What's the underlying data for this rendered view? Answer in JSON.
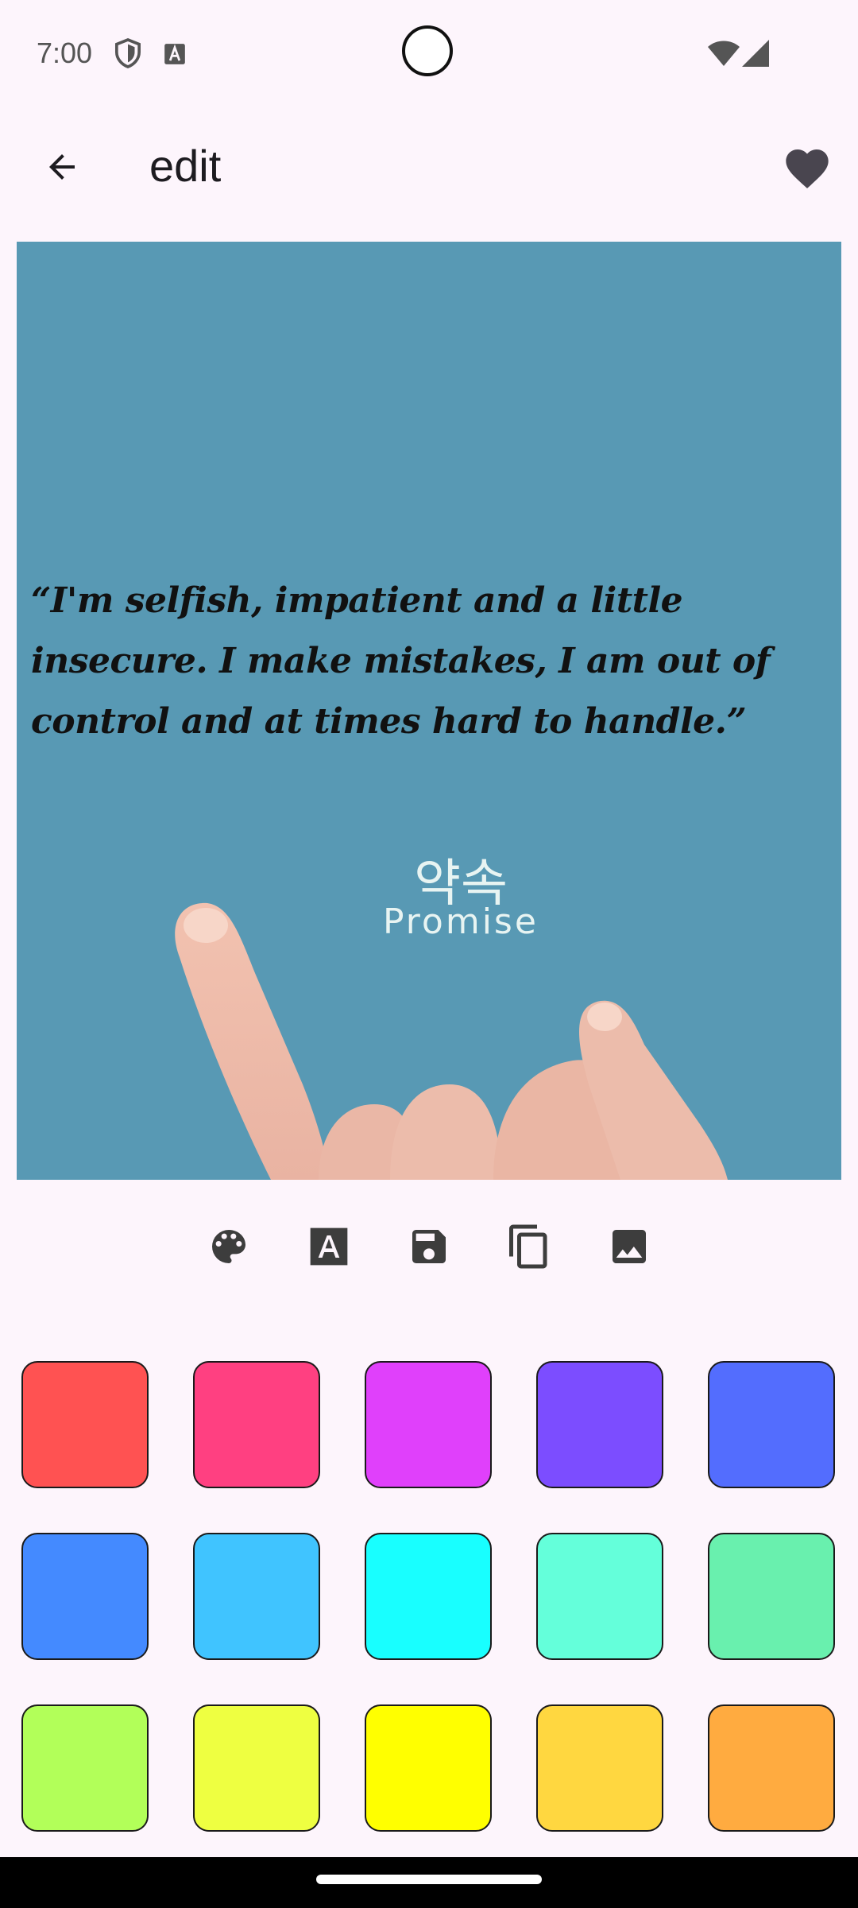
{
  "status_bar": {
    "time": "7:00"
  },
  "app_bar": {
    "title": "edit"
  },
  "preview": {
    "quote": "“I'm selfish, impatient and a little insecure. I make mistakes, I am out of control and at times hard to handle.”",
    "watermark_korean": "약속",
    "watermark_english": "Promise",
    "background_color": "#5899b4"
  },
  "toolbar": {
    "icons": [
      "palette-icon",
      "text-format-icon",
      "save-icon",
      "copy-icon",
      "image-icon"
    ]
  },
  "swatches": [
    [
      "#ff5252",
      "#ff4081",
      "#e040fb",
      "#7c4dff",
      "#536dfe"
    ],
    [
      "#448aff",
      "#40c4ff",
      "#18ffff",
      "#64ffda",
      "#69f0ae"
    ],
    [
      "#b2ff59",
      "#eeff41",
      "#ffff00",
      "#ffd740",
      "#ffab40"
    ]
  ]
}
